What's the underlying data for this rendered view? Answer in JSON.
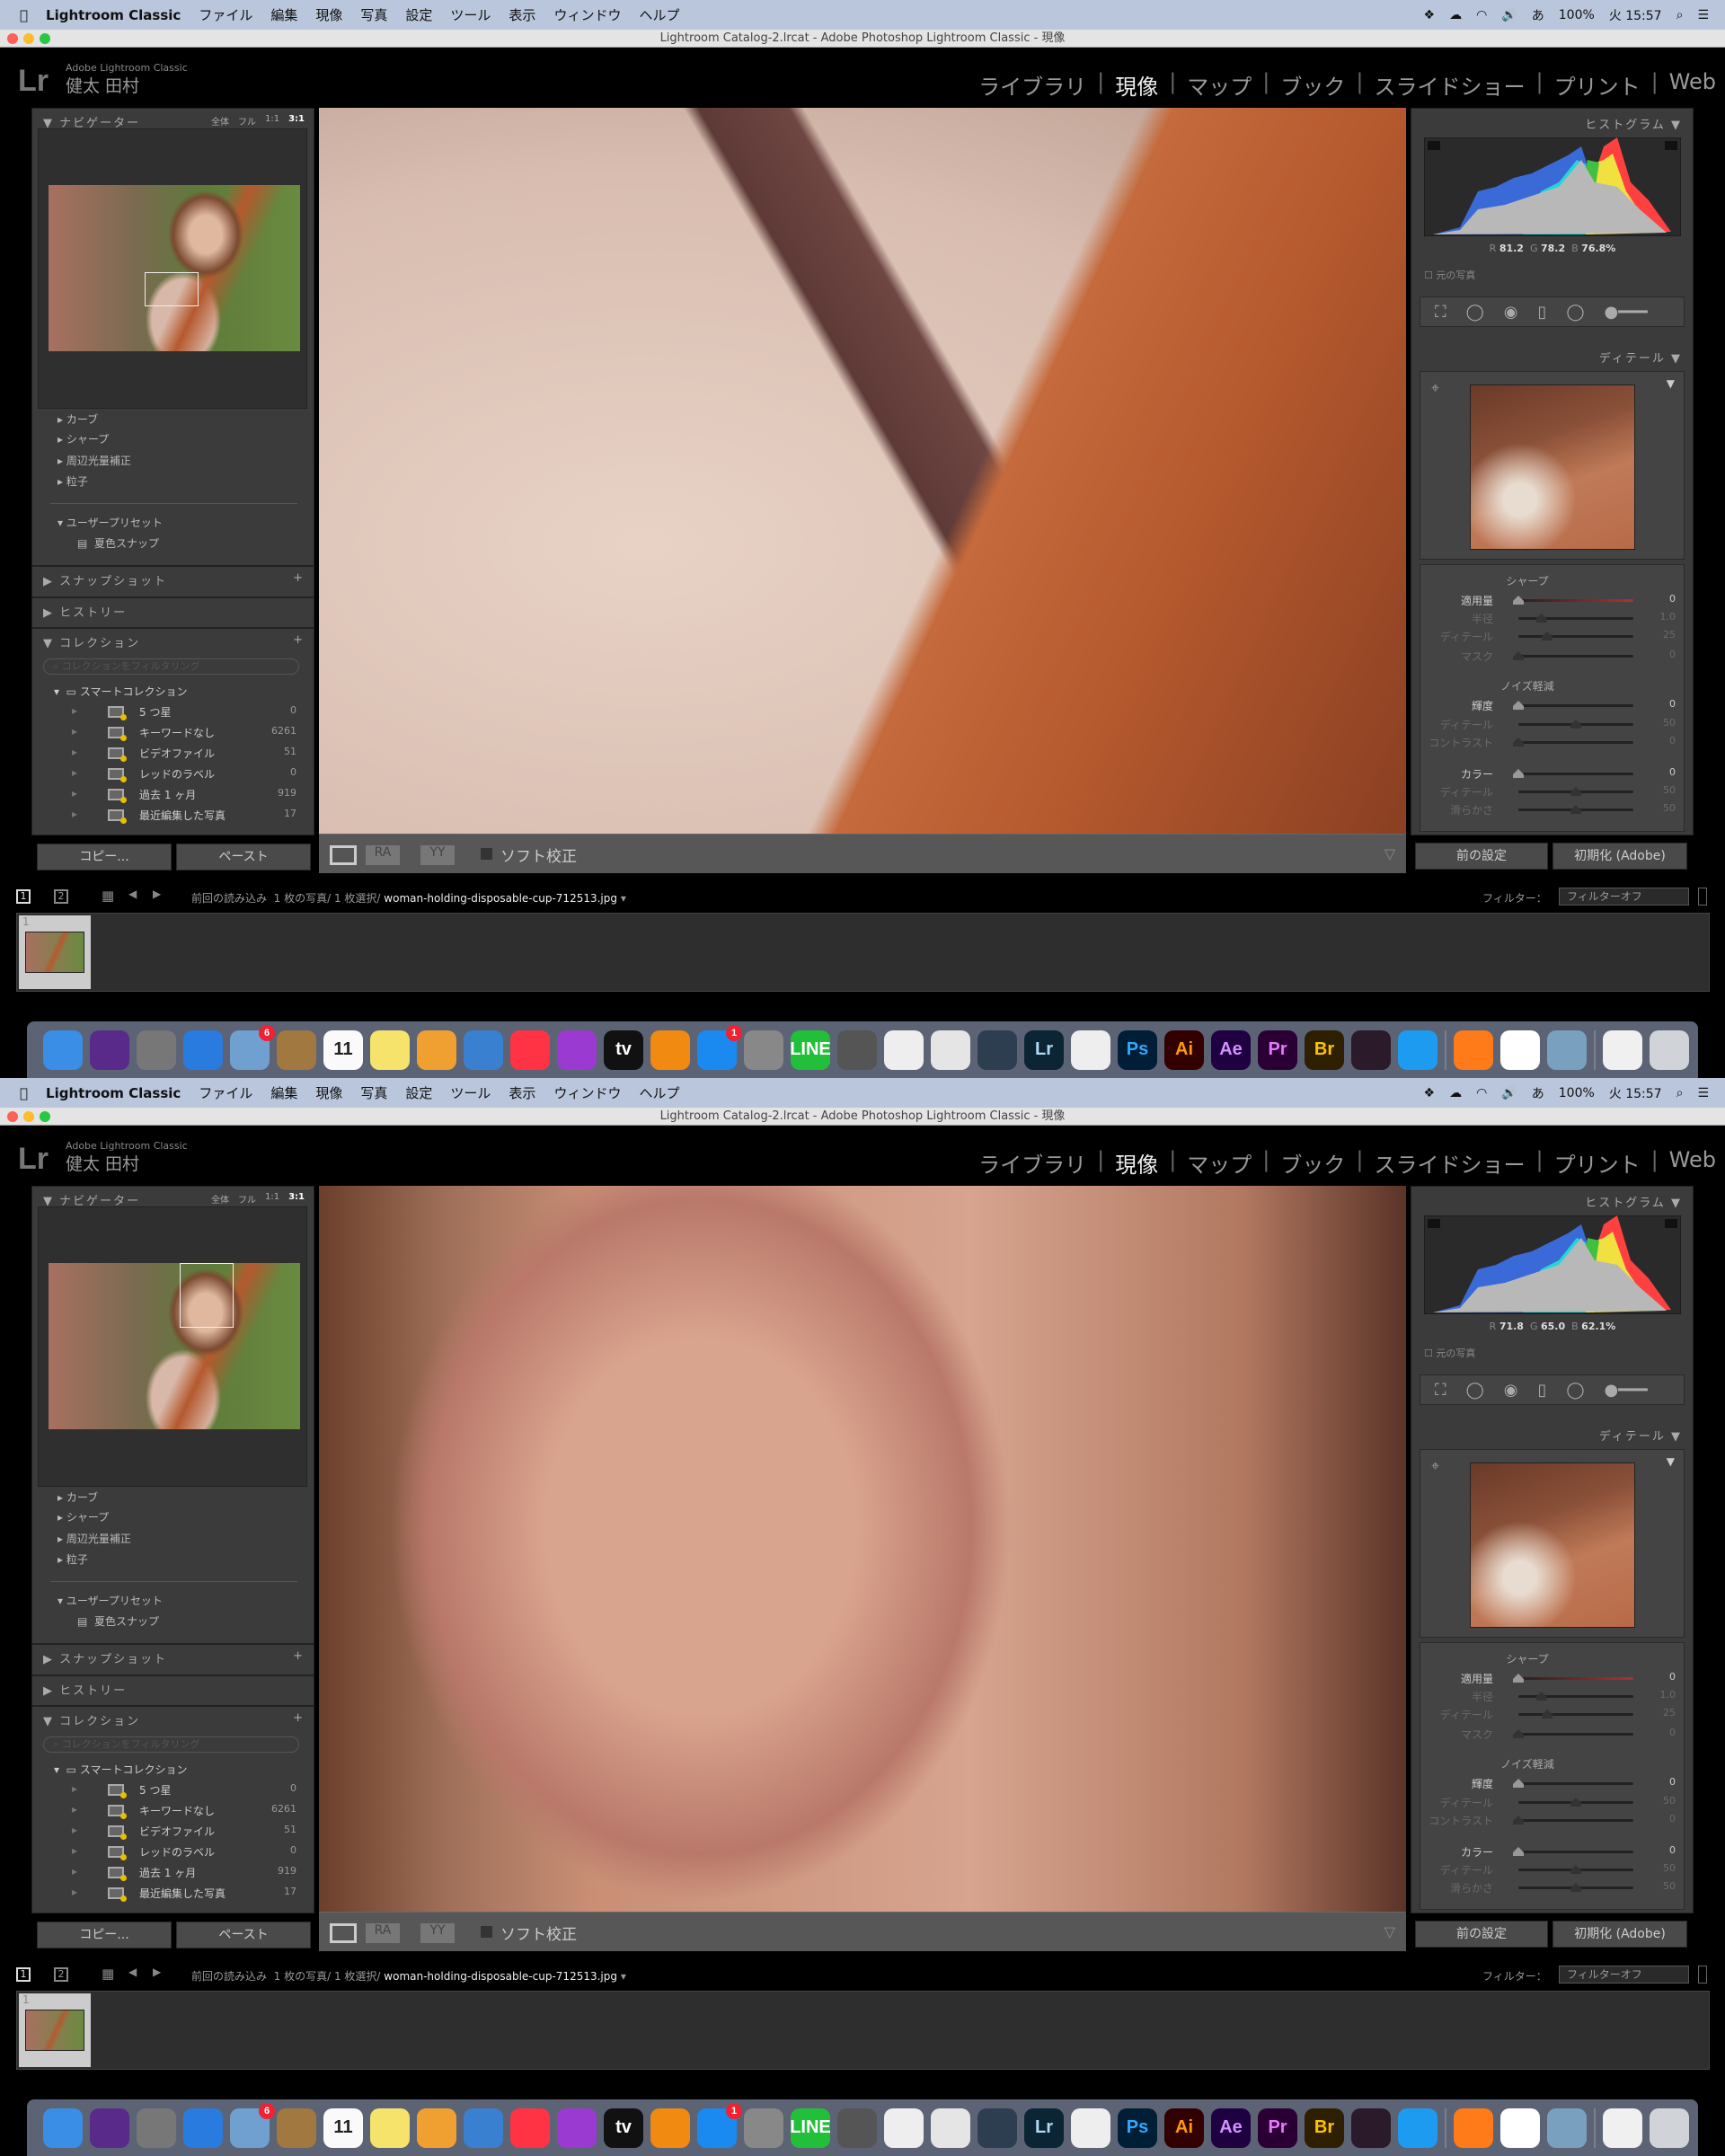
{
  "menubar": {
    "app": "Lightroom Classic",
    "items": [
      "ファイル",
      "編集",
      "現像",
      "写真",
      "設定",
      "ツール",
      "表示",
      "ウィンドウ",
      "ヘルプ"
    ],
    "battery": "100%",
    "clock": "火 15:57",
    "ime": "あ"
  },
  "window_title": "Lightroom Catalog-2.lrcat - Adobe Photoshop Lightroom Classic - 現像",
  "identity": {
    "logo": "Lr",
    "product": "Adobe Lightroom Classic",
    "user": "健太 田村"
  },
  "modules": [
    {
      "label": "ライブラリ",
      "active": false
    },
    {
      "label": "現像",
      "active": true
    },
    {
      "label": "マップ",
      "active": false
    },
    {
      "label": "ブック",
      "active": false
    },
    {
      "label": "スライドショー",
      "active": false
    },
    {
      "label": "プリント",
      "active": false
    },
    {
      "label": "Web",
      "active": false
    }
  ],
  "navigator": {
    "title": "ナビゲーター",
    "zoom_options": [
      "全体",
      "フル",
      "1:1",
      "3:1"
    ],
    "selected_zoom": "3:1"
  },
  "presets": {
    "items": [
      "カーブ",
      "シャープ",
      "周辺光量補正",
      "粒子"
    ],
    "user_presets": "ユーザープリセット",
    "user_preset_item": "夏色スナップ"
  },
  "snapshots": "スナップショット",
  "history": "ヒストリー",
  "collections": {
    "title": "コレクション",
    "filter_placeholder": "コレクションをフィルタリング",
    "smart": "スマートコレクション",
    "items": [
      {
        "name": "5 つ星",
        "count": "0"
      },
      {
        "name": "キーワードなし",
        "count": "6261"
      },
      {
        "name": "ビデオファイル",
        "count": "51"
      },
      {
        "name": "レッドのラベル",
        "count": "0"
      },
      {
        "name": "過去 1 ヶ月",
        "count": "919"
      },
      {
        "name": "最近編集した写真",
        "count": "17"
      }
    ]
  },
  "left_buttons": {
    "copy": "コピー...",
    "paste": "ペースト"
  },
  "toolbar": {
    "soft_proof": "ソフト校正",
    "ra": "RA",
    "yy": "YY"
  },
  "histogram": {
    "title": "ヒストグラム",
    "original": "元の写真",
    "r": "R",
    "g": "G",
    "b": "B"
  },
  "detail": {
    "title": "ディテール",
    "sharpen": {
      "title": "シャープ",
      "sliders": [
        {
          "label": "適用量",
          "value": "0",
          "pos": 0,
          "enabled": true
        },
        {
          "label": "半径",
          "value": "1.0",
          "pos": 0.2,
          "enabled": false
        },
        {
          "label": "ディテール",
          "value": "25",
          "pos": 0.25,
          "enabled": false
        },
        {
          "label": "マスク",
          "value": "0",
          "pos": 0,
          "enabled": false
        }
      ]
    },
    "noise": {
      "title": "ノイズ軽減",
      "sliders": [
        {
          "label": "輝度",
          "value": "0",
          "pos": 0,
          "enabled": true
        },
        {
          "label": "ディテール",
          "value": "50",
          "pos": 0.5,
          "enabled": false
        },
        {
          "label": "コントラスト",
          "value": "0",
          "pos": 0,
          "enabled": false
        }
      ]
    },
    "color": {
      "sliders": [
        {
          "label": "カラー",
          "value": "0",
          "pos": 0,
          "enabled": true
        },
        {
          "label": "ディテール",
          "value": "50",
          "pos": 0.5,
          "enabled": false
        },
        {
          "label": "滑らかさ",
          "value": "50",
          "pos": 0.5,
          "enabled": false
        }
      ]
    }
  },
  "right_buttons": {
    "previous": "前の設定",
    "reset": "初期化 (Adobe)"
  },
  "filmstrip": {
    "view1": "1",
    "view2": "2",
    "source": "前回の読み込み",
    "count": "1 枚の写真/ 1 枚選択/",
    "filename": "woman-holding-disposable-cup-712513.jpg",
    "filter_label": "フィルター：",
    "filter_value": "フィルターオフ",
    "thumb_index": "1"
  },
  "dock": [
    {
      "name": "finder",
      "bg": "#3a8ee6"
    },
    {
      "name": "siri",
      "bg": "#5a2a8a"
    },
    {
      "name": "launchpad",
      "bg": "#777"
    },
    {
      "name": "safari",
      "bg": "#2a7be0"
    },
    {
      "name": "mail",
      "bg": "#6fa0d0",
      "badge": "6"
    },
    {
      "name": "contacts",
      "bg": "#a07840"
    },
    {
      "name": "calendar",
      "bg": "#fafafa",
      "label": "11"
    },
    {
      "name": "notes",
      "bg": "#f5e36b"
    },
    {
      "name": "pages",
      "bg": "#f0a030"
    },
    {
      "name": "keynote",
      "bg": "#3a80d0"
    },
    {
      "name": "music",
      "bg": "#f34"
    },
    {
      "name": "podcasts",
      "bg": "#9b3ad0"
    },
    {
      "name": "apple-tv",
      "bg": "#111",
      "label": "tv"
    },
    {
      "name": "books",
      "bg": "#f08a10"
    },
    {
      "name": "app-store",
      "bg": "#1a8af0",
      "badge": "1"
    },
    {
      "name": "system-preferences",
      "bg": "#888"
    },
    {
      "name": "line",
      "bg": "#22c03a",
      "label": "LINE"
    },
    {
      "name": "quicktime",
      "bg": "#555"
    },
    {
      "name": "numbers",
      "bg": "#eee"
    },
    {
      "name": "chrome",
      "bg": "#e5e5e5"
    },
    {
      "name": "app",
      "bg": "#2c3e50"
    },
    {
      "name": "lightroom-classic",
      "bg": "#0b2534",
      "label": "Lr",
      "fg": "#b0d8f0"
    },
    {
      "name": "textedit",
      "bg": "#eee"
    },
    {
      "name": "photoshop",
      "bg": "#001e36",
      "label": "Ps",
      "fg": "#31a8ff"
    },
    {
      "name": "illustrator",
      "bg": "#330000",
      "label": "Ai",
      "fg": "#ff9a00"
    },
    {
      "name": "after-effects",
      "bg": "#1f0040",
      "label": "Ae",
      "fg": "#d291ff"
    },
    {
      "name": "premiere-pro",
      "bg": "#2a0034",
      "label": "Pr",
      "fg": "#ea77ff"
    },
    {
      "name": "bridge",
      "bg": "#2e1f00",
      "label": "Br",
      "fg": "#ffc400"
    },
    {
      "name": "rewards",
      "bg": "#2a1a2a"
    },
    {
      "name": "twitter",
      "bg": "#1d9bf0"
    },
    {
      "sep": true
    },
    {
      "name": "firefox",
      "bg": "#ff7b1a"
    },
    {
      "name": "slack",
      "bg": "#fff"
    },
    {
      "name": "preview",
      "bg": "#7aa0c0"
    },
    {
      "sep": true
    },
    {
      "name": "document",
      "bg": "#f0f0f0"
    },
    {
      "name": "trash",
      "bg": "#d0d4d8"
    }
  ],
  "screens": [
    {
      "rgb": {
        "r": "81.2",
        "g": "78.2",
        "b": "76.8%"
      },
      "photo": "coat-strap-scarf"
    },
    {
      "rgb": {
        "r": "71.8",
        "g": "65.0",
        "b": "62.1%"
      },
      "photo": "face"
    }
  ],
  "colors": {
    "panel": "#3b3b3b",
    "accent_active": "#eeeeee",
    "slider_red": "#b03030"
  }
}
